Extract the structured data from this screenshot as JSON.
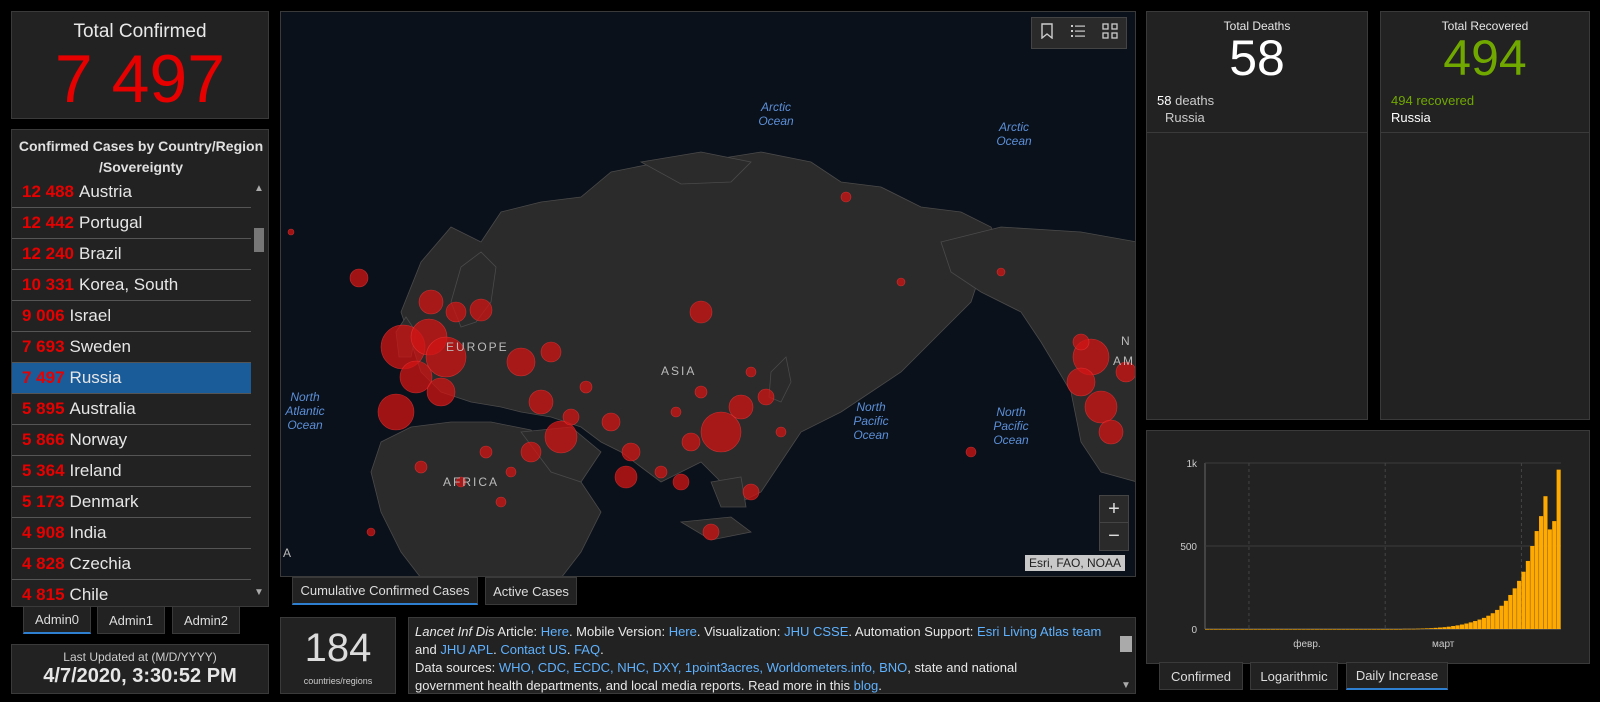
{
  "colors": {
    "confirmed_red": "#e60000",
    "recovered_green": "#70a800",
    "selected_blue": "#1a5b99",
    "chart_orange": "#ffaa00",
    "ocean_label": "#5b8fd8"
  },
  "total_confirmed": {
    "title": "Total Confirmed",
    "value": "7 497"
  },
  "country_list": {
    "title": "Confirmed Cases by Country/Region /Sovereignty",
    "items": [
      {
        "count": "12 488",
        "name": "Austria",
        "selected": false
      },
      {
        "count": "12 442",
        "name": "Portugal",
        "selected": false
      },
      {
        "count": "12 240",
        "name": "Brazil",
        "selected": false
      },
      {
        "count": "10 331",
        "name": "Korea, South",
        "selected": false
      },
      {
        "count": "9 006",
        "name": "Israel",
        "selected": false
      },
      {
        "count": "7 693",
        "name": "Sweden",
        "selected": false
      },
      {
        "count": "7 497",
        "name": "Russia",
        "selected": true
      },
      {
        "count": "5 895",
        "name": "Australia",
        "selected": false
      },
      {
        "count": "5 866",
        "name": "Norway",
        "selected": false
      },
      {
        "count": "5 364",
        "name": "Ireland",
        "selected": false
      },
      {
        "count": "5 173",
        "name": "Denmark",
        "selected": false
      },
      {
        "count": "4 908",
        "name": "India",
        "selected": false
      },
      {
        "count": "4 828",
        "name": "Czechia",
        "selected": false
      },
      {
        "count": "4 815",
        "name": "Chile",
        "selected": false
      }
    ]
  },
  "admin_tabs": [
    "Admin0",
    "Admin1",
    "Admin2"
  ],
  "last_updated": {
    "label": "Last Updated at (M/D/YYYY)",
    "value": "4/7/2020, 3:30:52 PM"
  },
  "map": {
    "labels": {
      "europe": "EUROPE",
      "asia": "ASIA",
      "africa": "AFRICA",
      "edge_a": "A",
      "edge_am": "AM",
      "edge_n": "N"
    },
    "oceans": {
      "arctic1": "Arctic Ocean",
      "arctic2": "Arctic Ocean",
      "north_atlantic": "North Atlantic Ocean",
      "north_pacific1": "North Pacific Ocean",
      "north_pacific2": "North Pacific Ocean"
    },
    "attribution": "Esri, FAO, NOAA",
    "toolbar_icons": [
      "bookmark-icon",
      "legend-list-icon",
      "basemap-gallery-icon"
    ],
    "zoom_in": "+",
    "zoom_out": "−"
  },
  "map_tabs": [
    "Cumulative Confirmed Cases",
    "Active Cases"
  ],
  "countries": {
    "value": "184",
    "label": "countries/regions"
  },
  "info": {
    "l1_article_label": "Lancet Inf Dis",
    "l1_article": "Article:",
    "l1_here1": "Here",
    "l1_mobile": ". Mobile Version:",
    "l1_here2": "Here",
    "l1_vis": ". Visualization:",
    "l1_jhu": "JHU CSSE",
    "l1_auto": ". Automation Support:",
    "l1_esri": "Esri Living Atlas team",
    "l2_and": "and",
    "l2_apl": "JHU APL",
    "l2_dot": ".",
    "l2_contact": "Contact US",
    "l2_faq": "FAQ",
    "l3_sources": "Data sources:",
    "l3_list": "WHO, CDC, ECDC, NHC, DXY, 1point3acres, Worldometers.info, BNO",
    "l3_rest": ", state and national",
    "l4_text": "government health departments, and local media reports.  Read more in this",
    "l4_blog": "blog"
  },
  "deaths": {
    "title": "Total Deaths",
    "value": "58",
    "count": "58",
    "label": "deaths",
    "country": "Russia"
  },
  "recovered": {
    "title": "Total Recovered",
    "value": "494",
    "count": "494",
    "label": "recovered",
    "country": "Russia"
  },
  "chart_tabs": [
    "Confirmed",
    "Logarithmic",
    "Daily Increase"
  ],
  "chart_data": {
    "type": "bar",
    "yticks": [
      "0",
      "500",
      "1k"
    ],
    "ylim": [
      0,
      1000
    ],
    "xticks": [
      "февр.",
      "март"
    ],
    "values": [
      0,
      0,
      0,
      0,
      0,
      0,
      0,
      0,
      0,
      0,
      0,
      0,
      0,
      0,
      0,
      0,
      0,
      0,
      0,
      0,
      0,
      0,
      0,
      0,
      0,
      0,
      0,
      0,
      0,
      0,
      0,
      0,
      0,
      0,
      0,
      0,
      0,
      0,
      0,
      0,
      0,
      0,
      0,
      0,
      0,
      1,
      1,
      1,
      2,
      3,
      4,
      5,
      7,
      9,
      11,
      14,
      18,
      22,
      27,
      33,
      40,
      48,
      57,
      67,
      80,
      95,
      115,
      140,
      170,
      205,
      245,
      290,
      345,
      410,
      500,
      590,
      680,
      800,
      600,
      650,
      960
    ]
  }
}
